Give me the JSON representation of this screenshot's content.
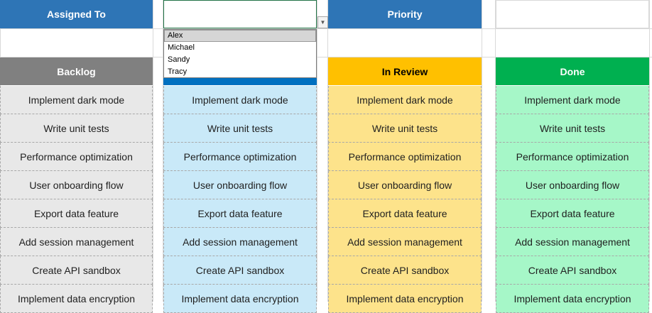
{
  "filters": {
    "assigned_to_label": "Assigned To",
    "assigned_to_value": "",
    "priority_label": "Priority",
    "priority_value": ""
  },
  "dropdown": {
    "options": [
      "Alex",
      "Michael",
      "Sandy",
      "Tracy"
    ],
    "highlighted": "Alex"
  },
  "columns": {
    "backlog": {
      "title": "Backlog",
      "color": "#808080",
      "text_color": "#ffffff"
    },
    "in_progress": {
      "title": "",
      "color": "#0070c0",
      "text_color": "#ffffff"
    },
    "in_review": {
      "title": "In Review",
      "color": "#ffc000",
      "text_color": "#000000"
    },
    "done": {
      "title": "Done",
      "color": "#00b050",
      "text_color": "#ffffff"
    }
  },
  "tasks": {
    "backlog": [
      "Implement dark mode",
      "Write unit tests",
      "Performance optimization",
      "User onboarding flow",
      "Export data feature",
      "Add session management",
      "Create API sandbox",
      "Implement data encryption"
    ],
    "in_progress": [
      "Implement dark mode",
      "Write unit tests",
      "Performance optimization",
      "User onboarding flow",
      "Export data feature",
      "Add session management",
      "Create API sandbox",
      "Implement data encryption"
    ],
    "in_review": [
      "Implement dark mode",
      "Write unit tests",
      "Performance optimization",
      "User onboarding flow",
      "Export data feature",
      "Add session management",
      "Create API sandbox",
      "Implement data encryption"
    ],
    "done": [
      "Implement dark mode",
      "Write unit tests",
      "Performance optimization",
      "User onboarding flow",
      "Export data feature",
      "Add session management",
      "Create API sandbox",
      "Implement data encryption"
    ]
  },
  "colors": {
    "filter_header": "#2e75b6",
    "backlog_cell": "#e8e8e8",
    "in_progress_cell": "#c9e9f8",
    "in_review_cell": "#fde38b",
    "done_cell": "#a6f7c8"
  }
}
